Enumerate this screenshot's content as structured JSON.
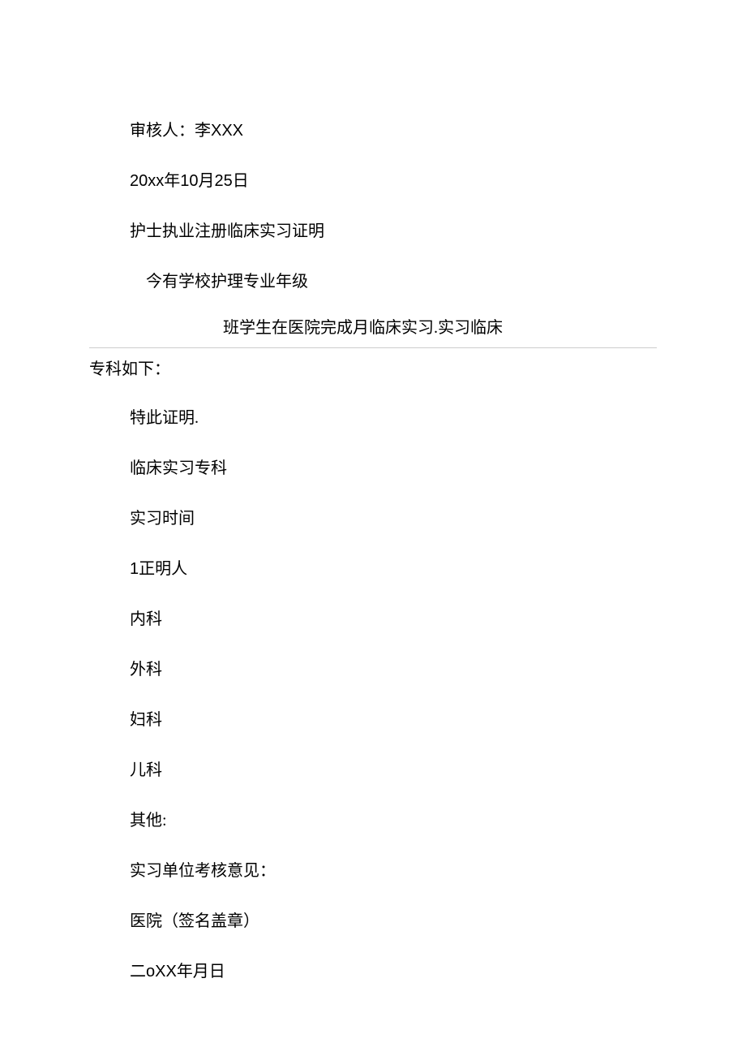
{
  "doc": {
    "reviewer_label": "审核人：李",
    "reviewer_name": "XXX",
    "date_prefix": "20xx",
    "date_mid": "年",
    "date_month": "10",
    "date_mid2": "月",
    "date_day": "25",
    "date_suffix": "日",
    "title": "护士执业注册临床实习证明",
    "intro_line": "今有学校护理专业年级",
    "underline_text": "班学生在医院完成月临床实习.实习临床",
    "after_underline": "专科如下：",
    "confirm": "特此证明.",
    "section_specialty": "临床实习专科",
    "section_time": "实习时间",
    "section_witness_num": "1",
    "section_witness": "正明人",
    "dept_internal": "内科",
    "dept_surgery": "外科",
    "dept_gyn": "妇科",
    "dept_ped": "儿科",
    "dept_other": "其他:",
    "eval_label": "实习单位考核意见：",
    "hospital_sign": "医院（签名盖章）",
    "date2_prefix": "二",
    "date2_mid": "oXX",
    "date2_suffix": "年月日"
  }
}
